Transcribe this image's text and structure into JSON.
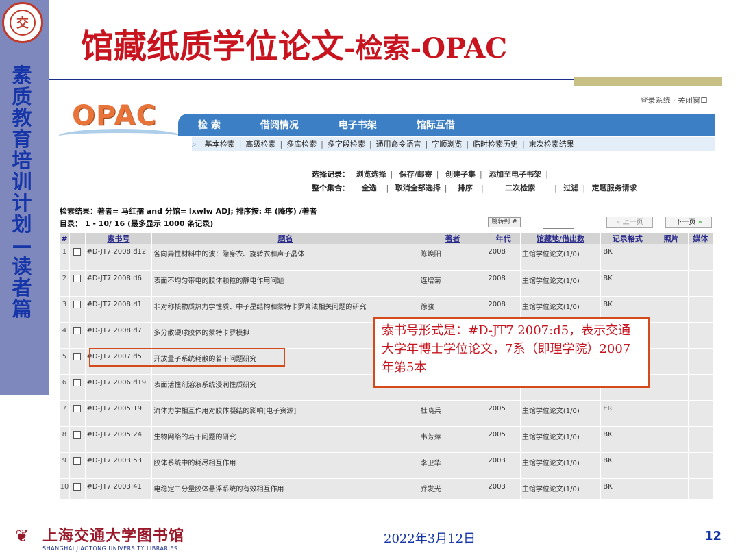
{
  "slide": {
    "title_main": "馆藏纸质学位论文",
    "title_sub": "-检索-OPAC",
    "side_title": "素质教育培训计划—读者篇",
    "logo_glyph": "交",
    "footer": {
      "library_cn": "上海交通大学图书馆",
      "library_en": "SHANGHAI JIAOTONG UNIVERSITY LIBRARIES",
      "date": "2022年3月12日",
      "page": "12"
    },
    "callout": "索书号形式是：#D-JT7 2007:d5，表示交通大学年博士学位论文，7系（即理学院）2007年第5本",
    "colors": {
      "title_red": "#c8141e",
      "sidebar": "#7f88bd",
      "nav_blue": "#3d7fc4",
      "highlight": "#d44a1a"
    }
  },
  "opac": {
    "logo": "OPAC",
    "top_links": "登录系统 · 关闭窗口",
    "nav": [
      "检  索",
      "借阅情况",
      "电子书架",
      "馆际互借"
    ],
    "sub_nav": [
      "基本检索",
      "高级检索",
      "多库检索",
      "多字段检索",
      "通用命令语言",
      "字顺浏览",
      "临时检索历史",
      "末次检索结果"
    ],
    "select_record_label": "选择记录：",
    "select_record_actions": [
      "浏览选择",
      "保存/邮寄",
      "创建子集",
      "添加至电子书架"
    ],
    "whole_set_label": "整个集合：",
    "whole_set_actions": [
      "全选",
      "取消全部选择",
      "排序",
      "二次检索",
      "过滤",
      "定题服务请求"
    ],
    "result_info": "检索结果：著者= 马红孺  and 分馆= lxwlw ADJ; 排序按: 年 (降序) /著者",
    "list_info": "目录：  1 - 10/ 16 (最多显示  1000 条记录)",
    "jump_label": "跳转到 #",
    "prev_label": "上一页",
    "next_label": "下一页",
    "columns": [
      "#",
      "",
      "索书号",
      "题名",
      "著者",
      "年代",
      "馆藏地/借出数",
      "记录格式",
      "照片",
      "媒体"
    ],
    "rows": [
      {
        "n": "1",
        "call": "#D-JT7 2008:d12",
        "title": "各向异性材料中的波：隐身衣、旋转衣和声子晶体",
        "author": "陈焕阳",
        "year": "2008",
        "loc": "主馆学位论文(1/0)",
        "fmt": "BK"
      },
      {
        "n": "2",
        "call": "#D-JT7 2008:d6",
        "title": "表面不均匀带电的胶体颗粒的静电作用问题",
        "author": "连增菊",
        "year": "2008",
        "loc": "主馆学位论文(1/0)",
        "fmt": "BK"
      },
      {
        "n": "3",
        "call": "#D-JT7 2008:d1",
        "title": "非对称核物质热力学性质、中子星结构和蒙特卡罗算法相关问题的研究",
        "author": "徐骏",
        "year": "2008",
        "loc": "主馆学位论文(1/0)",
        "fmt": "BK"
      },
      {
        "n": "4",
        "call": "#D-JT7 2008:d7",
        "title": "多分散硬球胶体的蒙特卡罗模拟",
        "author": "",
        "year": "",
        "loc": "",
        "fmt": ""
      },
      {
        "n": "5",
        "call": "#D-JT7 2007:d5",
        "title": "开放量子系统耗散的若干问题研究",
        "author": "",
        "year": "",
        "loc": "",
        "fmt": ""
      },
      {
        "n": "6",
        "call": "#D-JT7 2006:d19",
        "title": "表面活性剂溶液系统浸润性质研究",
        "author": "",
        "year": "",
        "loc": "",
        "fmt": ""
      },
      {
        "n": "7",
        "call": "#D-JT7 2005:19",
        "title": "流体力学相互作用对胶体凝结的影响[电子资源]",
        "author": "杜晓兵",
        "year": "2005",
        "loc": "主馆学位论文(1/0)",
        "fmt": "ER"
      },
      {
        "n": "8",
        "call": "#D-JT7 2005:24",
        "title": "生物网络的若干问题的研究",
        "author": "韦芳萍",
        "year": "2005",
        "loc": "主馆学位论文(1/0)",
        "fmt": "BK"
      },
      {
        "n": "9",
        "call": "#D-JT7 2003:53",
        "title": "胶体系统中的耗尽相互作用",
        "author": "李卫华",
        "year": "2003",
        "loc": "主馆学位论文(1/0)",
        "fmt": "BK"
      },
      {
        "n": "10",
        "call": "#D-JT7 2003:41",
        "title": "电稳定二分量胶体悬浮系统的有效相互作用",
        "author": "乔发光",
        "year": "2003",
        "loc": "主馆学位论文(1/0)",
        "fmt": "BK"
      }
    ]
  }
}
